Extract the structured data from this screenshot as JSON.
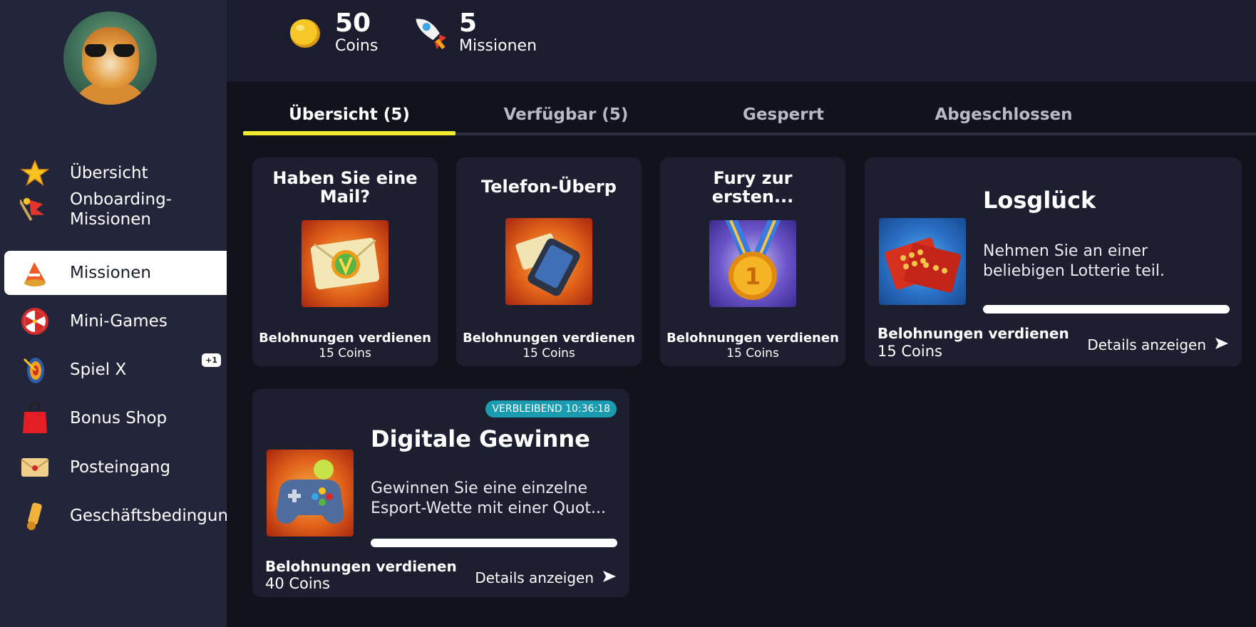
{
  "sidebar": {
    "items": [
      {
        "label": "Übersicht",
        "icon": "star-icon"
      },
      {
        "label": "Onboarding-Missionen",
        "icon": "flag-icon"
      },
      {
        "label": "Missionen",
        "icon": "megaphone-icon"
      },
      {
        "label": "Mini-Games",
        "icon": "wheel-icon"
      },
      {
        "label": "Spiel X",
        "icon": "target-icon",
        "badge": "+1"
      },
      {
        "label": "Bonus Shop",
        "icon": "shopping-bag-icon"
      },
      {
        "label": "Posteingang",
        "icon": "envelope-icon"
      },
      {
        "label": "Geschäftsbedingungen",
        "icon": "scroll-icon"
      }
    ],
    "active_index": 2
  },
  "header": {
    "coins": {
      "value": "50",
      "label": "Coins",
      "icon": "coin-icon"
    },
    "missions": {
      "value": "5",
      "label": "Missionen",
      "icon": "rocket-icon"
    }
  },
  "tabs": [
    {
      "label": "Übersicht (5)",
      "active": true
    },
    {
      "label": "Verfügbar (5)",
      "active": false
    },
    {
      "label": "Gesperrt",
      "active": false
    },
    {
      "label": "Abgeschlossen",
      "active": false
    }
  ],
  "missions": {
    "card1": {
      "title": "Haben Sie eine Mail?",
      "reward_label": "Belohnungen verdienen",
      "reward_value": "15 Coins",
      "icon": "mail-check-icon"
    },
    "card2": {
      "title": "Telefon-Überp",
      "reward_label": "Belohnungen verdienen",
      "reward_value": "15 Coins",
      "icon": "phone-mail-icon"
    },
    "card3": {
      "title": "Fury zur ersten...",
      "reward_label": "Belohnungen verdienen",
      "reward_value": "15 Coins",
      "icon": "medal-icon"
    },
    "card4": {
      "title": "Losglück",
      "description": "Nehmen Sie an einer beliebigen Lotterie teil.",
      "reward_label": "Belohnungen verdienen",
      "reward_value": "15 Coins",
      "details_label": "Details anzeigen",
      "icon": "lottery-tickets-icon",
      "progress": 0
    },
    "card5": {
      "title": "Digitale Gewinne",
      "description": "Gewinnen Sie eine einzelne Esport-Wette mit einer Quot...",
      "reward_label": "Belohnungen verdienen",
      "reward_value": "40 Coins",
      "details_label": "Details anzeigen",
      "countdown": "VERBLEIBEND 10:36:18",
      "icon": "gamepad-icon",
      "progress": 0
    }
  },
  "colors": {
    "background": "#11121c",
    "sidebar": "#23253a",
    "card": "#1d1f31",
    "tab_indicator": "#f2ec2e",
    "countdown_badge": "#1a9bb0"
  }
}
